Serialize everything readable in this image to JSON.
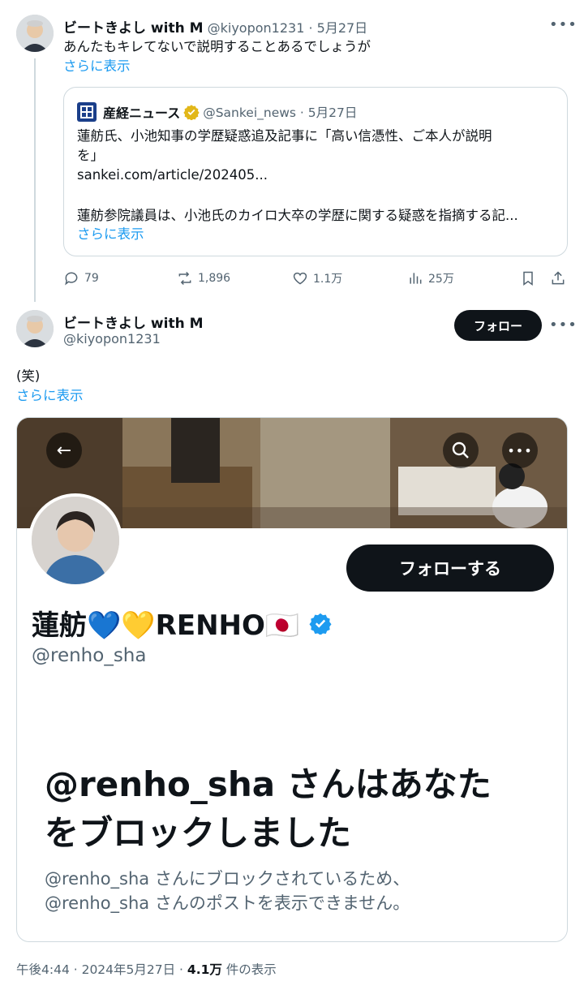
{
  "tweet1": {
    "display_name": "ビートきよし with M",
    "handle_date": "@kiyopon1231 · 5月27日",
    "text": "あんたもキレてないで説明することあるでしょうが",
    "show_more": "さらに表示",
    "more_icon": "more-dots-icon"
  },
  "quote": {
    "display_name": "産経ニュース",
    "handle_date": "@Sankei_news · 5月27日",
    "line1": "蓮舫氏、小池知事の学歴疑惑追及記事に「高い信憑性、ご本人が説明",
    "line2": "を」",
    "line3": "sankei.com/article/202405...",
    "line4": "蓮舫参院議員は、小池氏のカイロ大卒の学歴に関する疑惑を指摘する記...",
    "show_more": "さらに表示"
  },
  "actions": {
    "replies": "79",
    "reposts": "1,896",
    "likes": "1.1万",
    "views": "25万"
  },
  "tweet2": {
    "display_name": "ビートきよし with M",
    "handle": "@kiyopon1231",
    "follow_label": "フォロー",
    "text": "(笑)",
    "show_more": "さらに表示"
  },
  "media": {
    "follow_label": "フォローする",
    "profile_name": "蓮舫💙💛RENHO🇯🇵",
    "profile_handle": "@renho_sha",
    "blocked_title_line1": "@renho_sha さんはあなた",
    "blocked_title_line2": "をブロックしました",
    "blocked_sub_line1": "@renho_sha さんにブロックされているため、",
    "blocked_sub_line2": "@renho_sha さんのポストを表示できません。"
  },
  "footer": {
    "time_date": "午後4:44 · 2024年5月27日 · ",
    "views_count": "4.1万",
    "views_label": " 件の表示"
  },
  "colors": {
    "link": "#1d9bf0",
    "verified_gold": "#e2b719",
    "verified_blue": "#1d9bf0"
  }
}
